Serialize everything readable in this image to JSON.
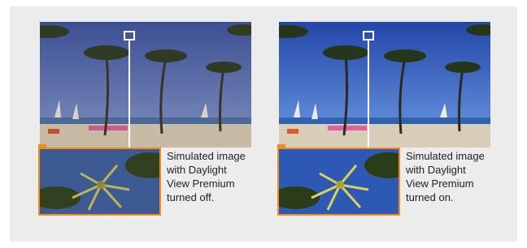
{
  "examples": [
    {
      "id": "off",
      "caption_lines": [
        "Simulated image",
        "with Daylight",
        "View Premium",
        "turned off."
      ],
      "colors": {
        "sky_top": "#3c4f93",
        "sky_bottom": "#6f7fb3",
        "sea": "#4a6a9a",
        "sand": "#c7bba5",
        "crop_sky": "#3e5a93",
        "frond": "#bcb45a"
      }
    },
    {
      "id": "on",
      "caption_lines": [
        "Simulated image",
        "with Daylight",
        "View Premium",
        "turned on."
      ],
      "colors": {
        "sky_top": "#2346a8",
        "sky_bottom": "#5b86d6",
        "sea": "#2f63b0",
        "sand": "#d8cdb6",
        "crop_sky": "#2d58b3",
        "frond": "#d9d35a"
      }
    }
  ],
  "accent_colors": {
    "crop_border": "#f08c1e",
    "zoom_frame": "#ffffff",
    "panel_bg": "#ececec"
  },
  "icons": [
    "palm-tree-icon",
    "zoom-frame-icon"
  ]
}
